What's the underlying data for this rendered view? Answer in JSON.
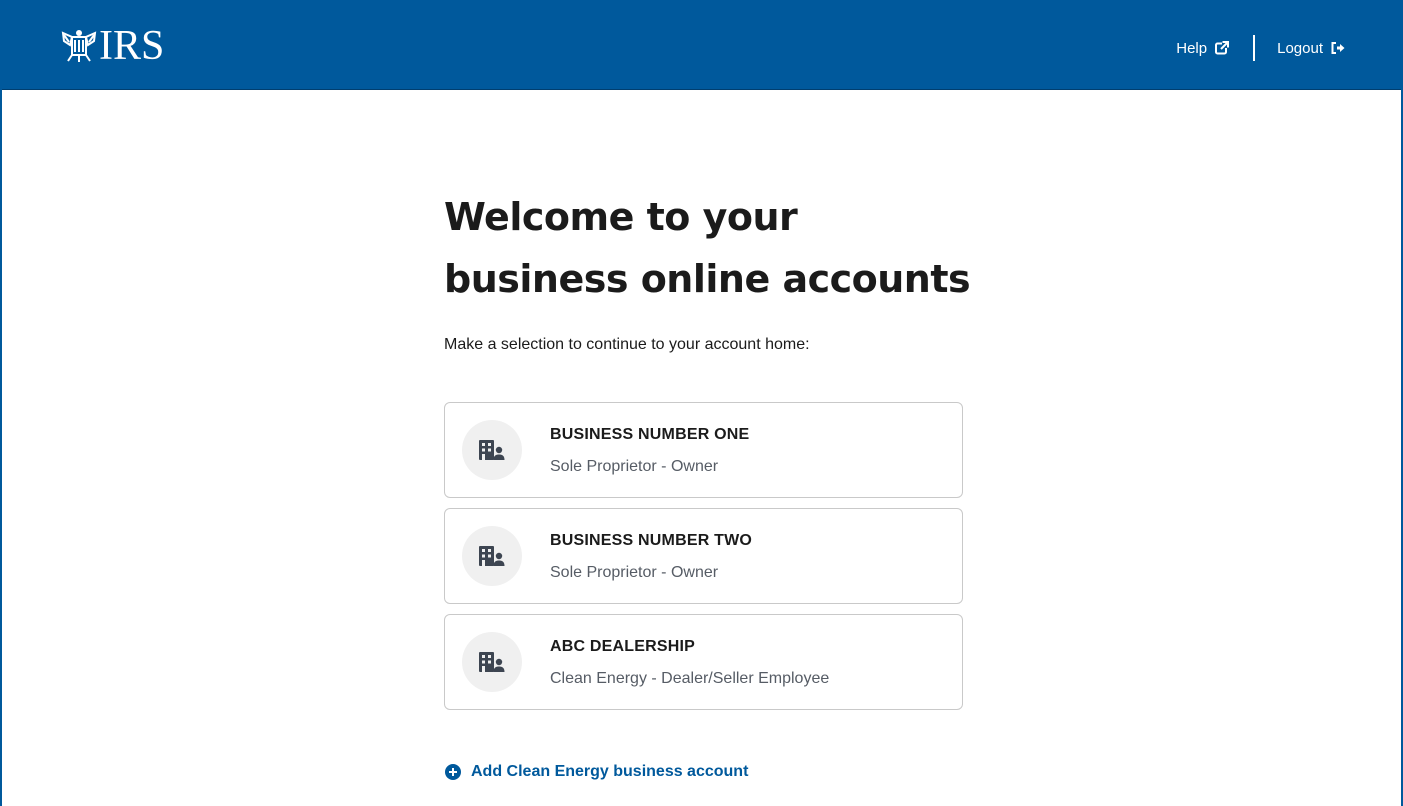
{
  "header": {
    "logo_text": "IRS",
    "help_label": "Help",
    "logout_label": "Logout"
  },
  "main": {
    "title_line1": "Welcome to your",
    "title_line2": "business online accounts",
    "subtitle": "Make a selection to continue to your account home:"
  },
  "accounts": [
    {
      "name": "BUSINESS NUMBER ONE",
      "role": "Sole Proprietor - Owner",
      "icon": "business-user-icon"
    },
    {
      "name": "BUSINESS NUMBER TWO",
      "role": "Sole Proprietor - Owner",
      "icon": "business-user-icon"
    },
    {
      "name": "ABC DEALERSHIP",
      "role": "Clean Energy - Dealer/Seller Employee",
      "icon": "business-user-icon"
    }
  ],
  "add_account": {
    "label": "Add Clean Energy business account"
  },
  "colors": {
    "brand_blue": "#00599c",
    "text_dark": "#1b1b1b",
    "text_muted": "#565c65",
    "card_border": "#c9c9c9",
    "icon_bg": "#f0f0f0"
  }
}
